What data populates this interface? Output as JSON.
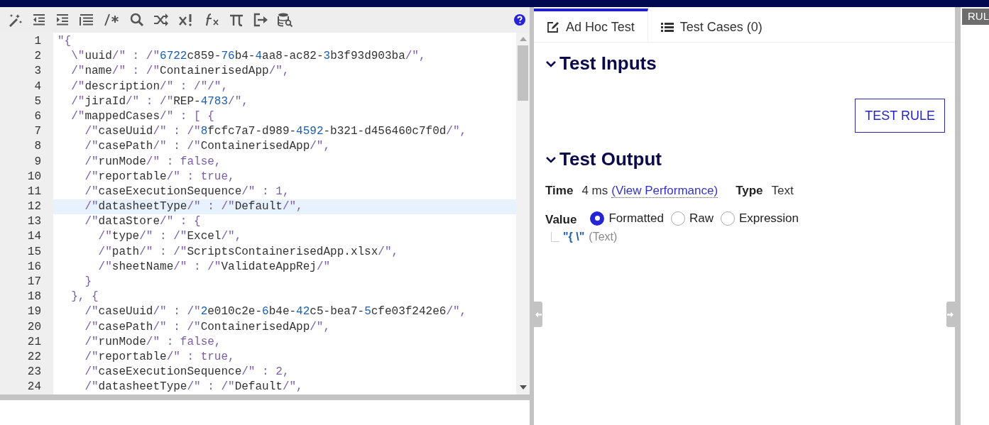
{
  "editor": {
    "lines": [
      {
        "number": "1",
        "text": "\"{",
        "current": false
      },
      {
        "number": "2",
        "text": "  \\\"uuid/\" : /\"6722c859-76b4-4aa8-ac82-3b3f93d903ba/\",",
        "current": false
      },
      {
        "number": "3",
        "text": "  /\"name/\" : /\"ContainerisedApp/\",",
        "current": false
      },
      {
        "number": "4",
        "text": "  /\"description/\" : /\"/\",",
        "current": false
      },
      {
        "number": "5",
        "text": "  /\"jiraId/\" : /\"REP-4783/\",",
        "current": false
      },
      {
        "number": "6",
        "text": "  /\"mappedCases/\" : [ {",
        "current": false
      },
      {
        "number": "7",
        "text": "    /\"caseUuid/\" : /\"8fcfc7a7-d989-4592-b321-d456460c7f0d/\",",
        "current": false
      },
      {
        "number": "8",
        "text": "    /\"casePath/\" : /\"ContainerisedApp/\",",
        "current": false
      },
      {
        "number": "9",
        "text": "    /\"runMode/\" : false,",
        "current": false
      },
      {
        "number": "10",
        "text": "    /\"reportable/\" : true,",
        "current": false
      },
      {
        "number": "11",
        "text": "    /\"caseExecutionSequence/\" : 1,",
        "current": false
      },
      {
        "number": "12",
        "text": "    /\"datasheetType/\" : /\"Default/\",",
        "current": true
      },
      {
        "number": "13",
        "text": "    /\"dataStore/\" : {",
        "current": false
      },
      {
        "number": "14",
        "text": "      /\"type/\" : /\"Excel/\",",
        "current": false
      },
      {
        "number": "15",
        "text": "      /\"path/\" : /\"ScriptsContainerisedApp.xlsx/\",",
        "current": false
      },
      {
        "number": "16",
        "text": "      /\"sheetName/\" : /\"ValidateAppRej/\"",
        "current": false
      },
      {
        "number": "17",
        "text": "    }",
        "current": false
      },
      {
        "number": "18",
        "text": "  }, {",
        "current": false
      },
      {
        "number": "19",
        "text": "    /\"caseUuid/\" : /\"2e010c2e-6b4e-42c5-bea7-5cfe03f242e6/\",",
        "current": false
      },
      {
        "number": "20",
        "text": "    /\"casePath/\" : /\"ContainerisedApp/\",",
        "current": false
      },
      {
        "number": "21",
        "text": "    /\"runMode/\" : false,",
        "current": false
      },
      {
        "number": "22",
        "text": "    /\"reportable/\" : true,",
        "current": false
      },
      {
        "number": "23",
        "text": "    /\"caseExecutionSequence/\" : 2,",
        "current": false
      },
      {
        "number": "24",
        "text": "    /\"datasheetType/\" : /\"Default/\",",
        "current": false
      }
    ]
  },
  "tabs": [
    {
      "label": "Ad Hoc Test",
      "kind": "edit",
      "selected": true
    },
    {
      "label": "Test Cases (0)",
      "kind": "list",
      "selected": false
    }
  ],
  "test_inputs": {
    "title": "Test Inputs",
    "expanded": true,
    "button": "TEST RULE"
  },
  "test_output": {
    "title": "Test Output",
    "expanded": true,
    "time_label": "Time",
    "time": "4 ms",
    "performance_link": "(View Performance)",
    "type_label": "Type",
    "type": "Text",
    "value_label": "Value",
    "value_modes": [
      {
        "label": "Formatted",
        "selected": true
      },
      {
        "label": "Raw",
        "selected": false
      },
      {
        "label": "Expression",
        "selected": false
      }
    ],
    "tree_value": "\"{ \\\"",
    "tree_type": "(Text)"
  },
  "side_tab": "RUL"
}
